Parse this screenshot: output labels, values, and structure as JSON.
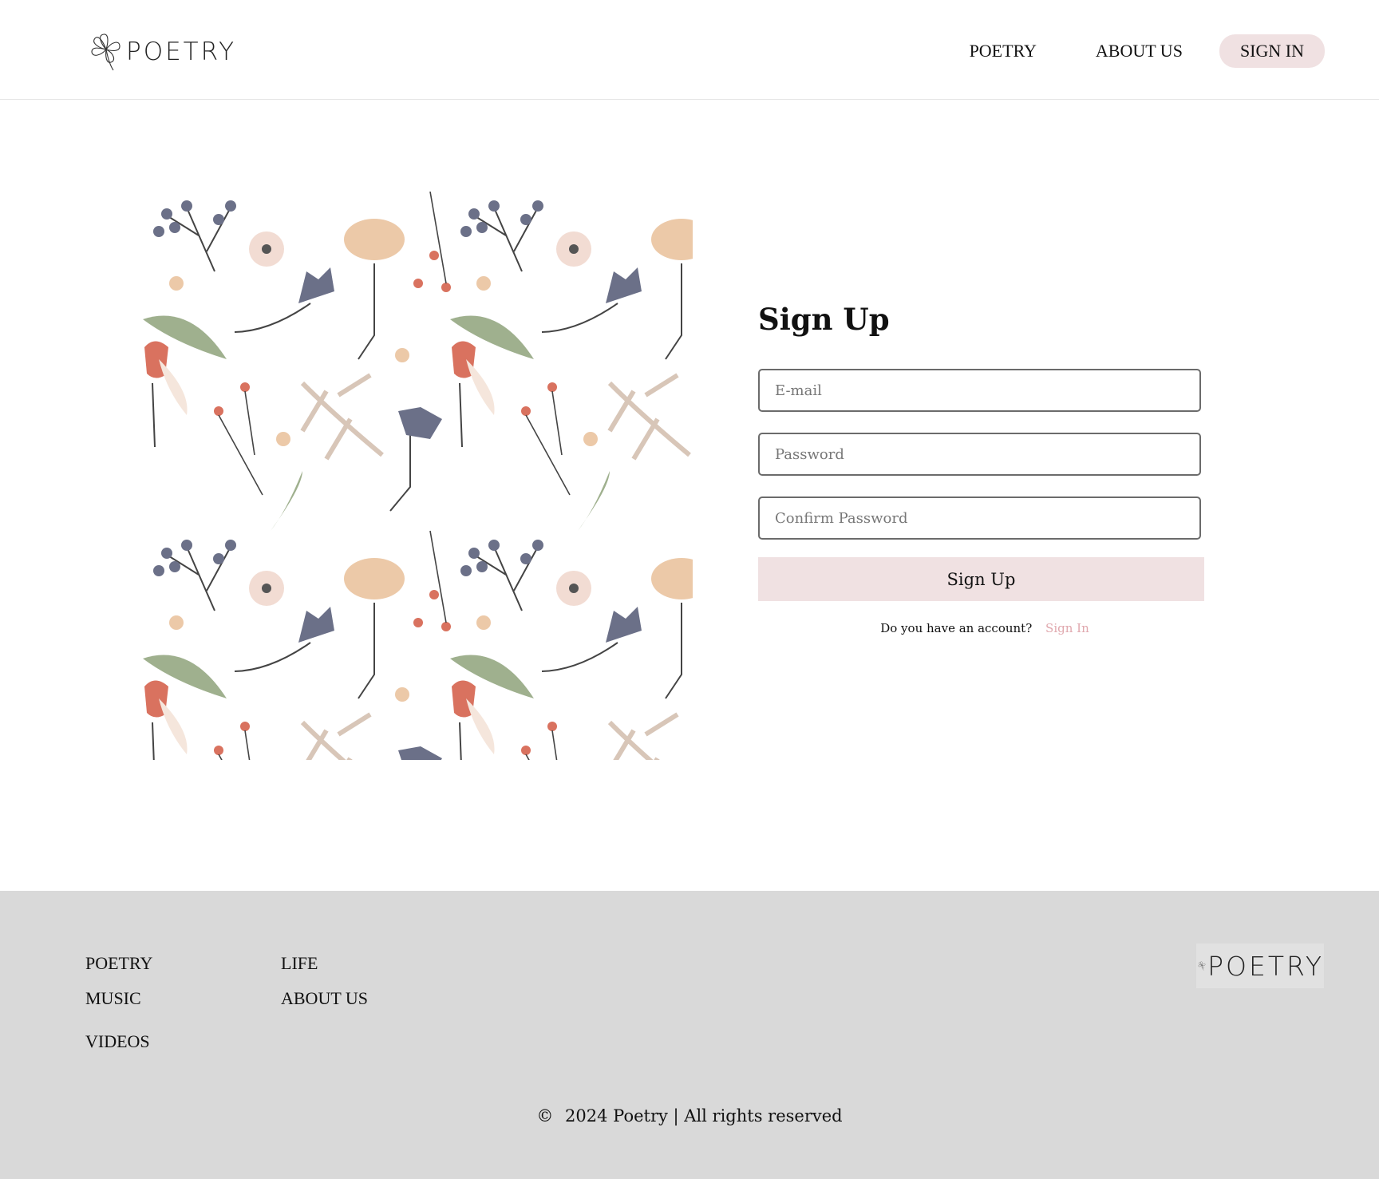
{
  "brand": {
    "logo_text": "POETRY"
  },
  "nav": {
    "items": [
      {
        "label": "POETRY"
      },
      {
        "label": "ABOUT US"
      }
    ],
    "signin_label": "SIGN IN"
  },
  "signup": {
    "title": "Sign Up",
    "email_placeholder": "E-mail",
    "password_placeholder": "Password",
    "confirm_placeholder": "Confirm Password",
    "submit_label": "Sign Up",
    "account_question": "Do you have an account?",
    "signin_link": "Sign In"
  },
  "footer": {
    "col1": [
      "POETRY",
      "MUSIC",
      "VIDEOS"
    ],
    "col2": [
      "LIFE",
      "ABOUT US"
    ],
    "copyright_symbol": "©",
    "copyright_text": "2024 Poetry | All rights reserved"
  },
  "colors": {
    "accent_pink": "#f0e1e2",
    "link_pink": "#e0a8ae",
    "footer_bg": "#d9d9d9"
  }
}
